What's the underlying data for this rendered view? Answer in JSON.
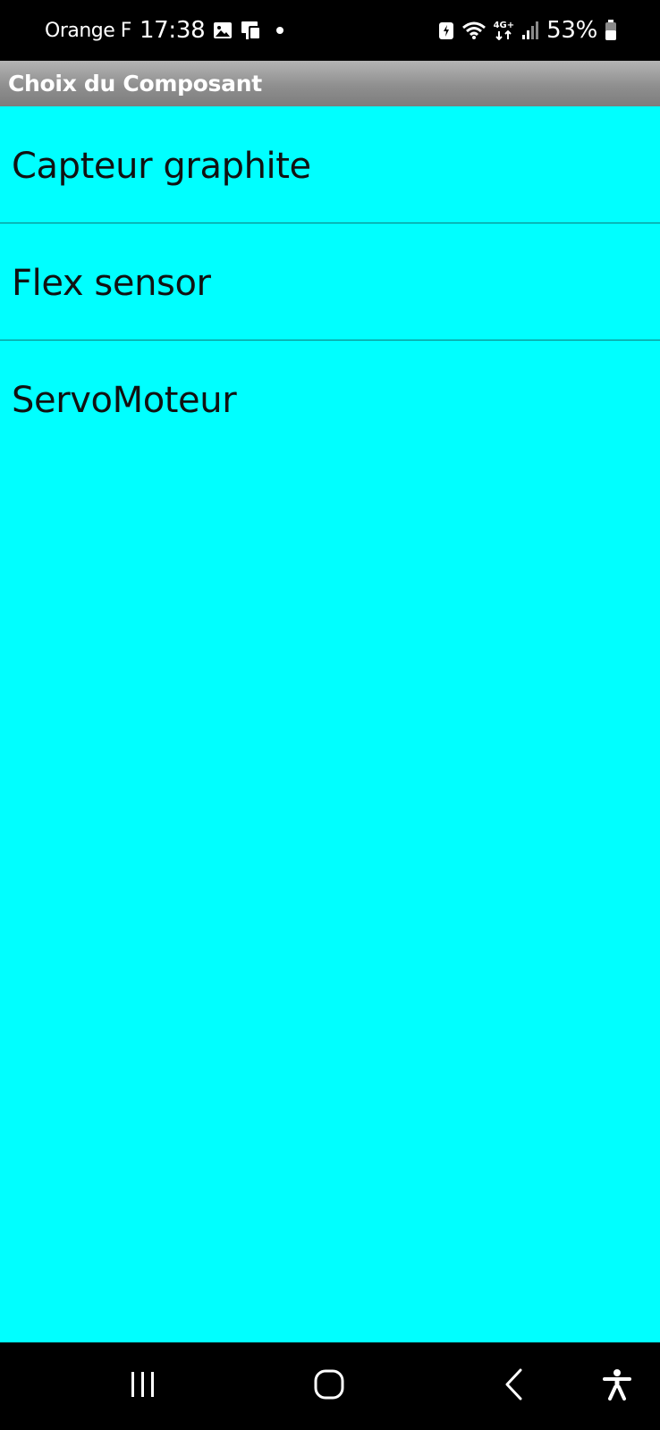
{
  "status_bar": {
    "carrier": "Orange F",
    "time": "17:38",
    "network_type": "4G+",
    "battery_percent": "53%",
    "icons": [
      "gallery-icon",
      "cast-icon",
      "notification-dot-icon",
      "battery-saver-icon",
      "wifi-icon",
      "network-arrows-icon",
      "signal-icon",
      "battery-icon"
    ]
  },
  "title_bar": {
    "title": "Choix du Composant"
  },
  "list": {
    "items": [
      {
        "label": "Capteur graphite"
      },
      {
        "label": "Flex sensor"
      },
      {
        "label": "ServoMoteur"
      }
    ]
  },
  "nav_bar": {
    "buttons": [
      "recent-apps-icon",
      "home-icon",
      "back-icon",
      "accessibility-icon"
    ]
  },
  "colors": {
    "background": "#00FFFF",
    "title_bar_top": "#B4B4B4",
    "title_bar_bottom": "#7D7D7D",
    "text": "#111111",
    "divider": "#0E7F7F"
  }
}
